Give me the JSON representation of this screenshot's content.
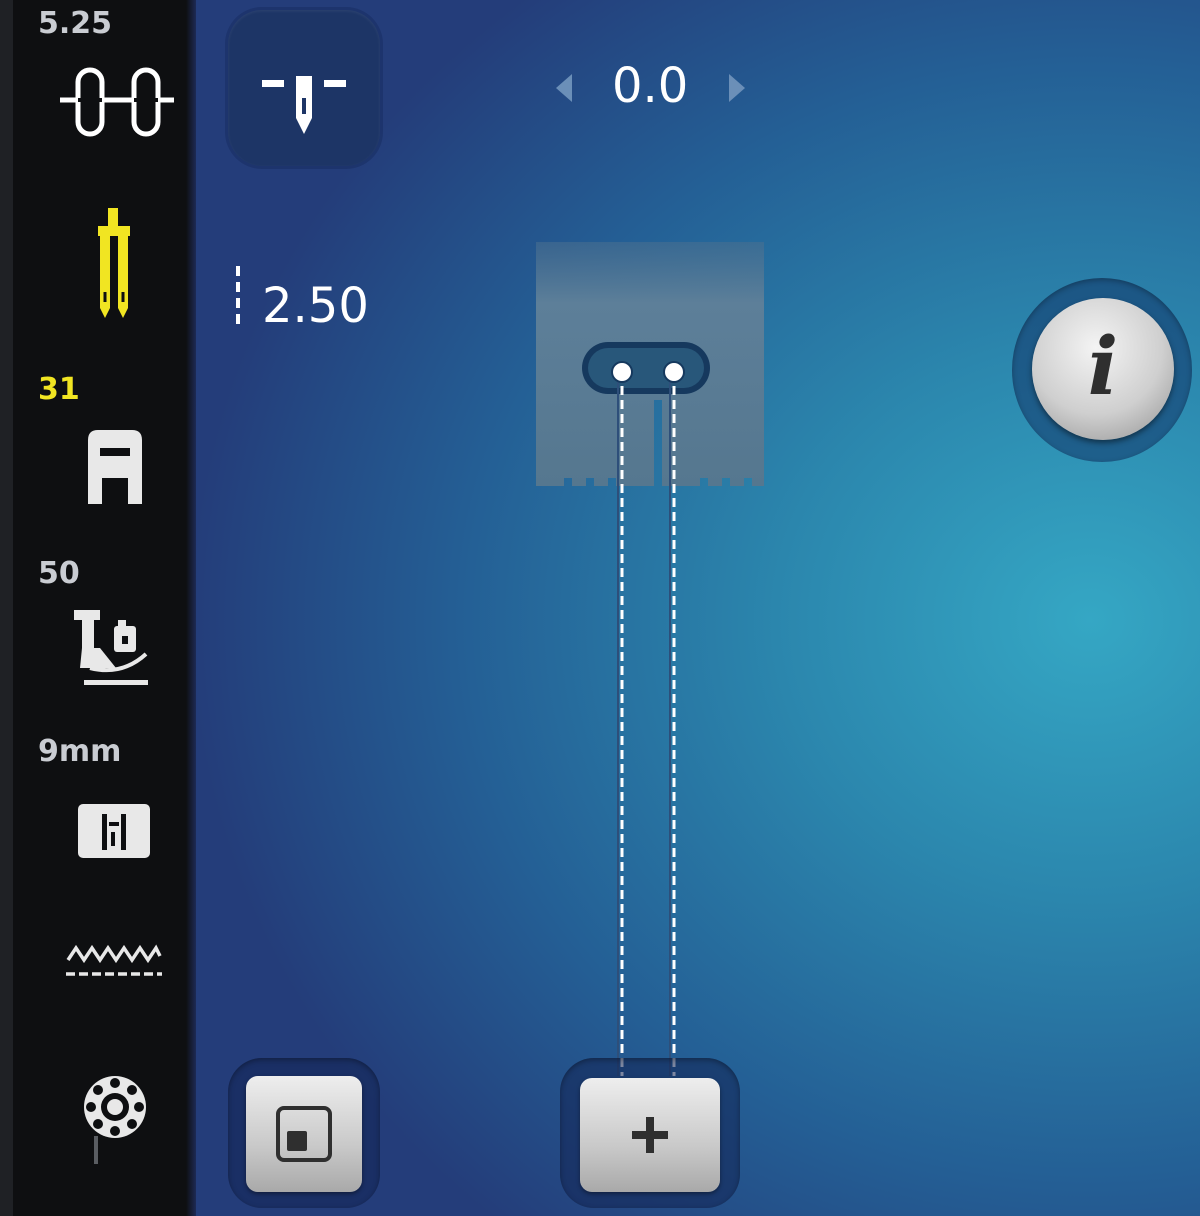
{
  "sidebar": {
    "needle_size": "5.25",
    "presser_foot_number": "31",
    "presser_foot_pressure": "50",
    "stitch_plate": "9mm"
  },
  "settings": {
    "needle_position": "0.0",
    "twin_needle_distance": "2.50"
  },
  "info_button": {
    "label": "i"
  },
  "colors": {
    "active_highlight": "#f1e522",
    "background_accent": "#35a7c4"
  },
  "icons": {
    "thread": "thread-loop-icon",
    "twin_needle": "twin-needle-icon",
    "presser_foot": "presser-foot-icon",
    "pressure": "presser-foot-pressure-icon",
    "stitch_plate": "stitch-plate-icon",
    "feed_dog": "feed-dog-icon",
    "bobbin": "bobbin-icon",
    "needle_stop": "needle-stop-icon",
    "square": "square-icon",
    "plus": "plus-icon"
  }
}
